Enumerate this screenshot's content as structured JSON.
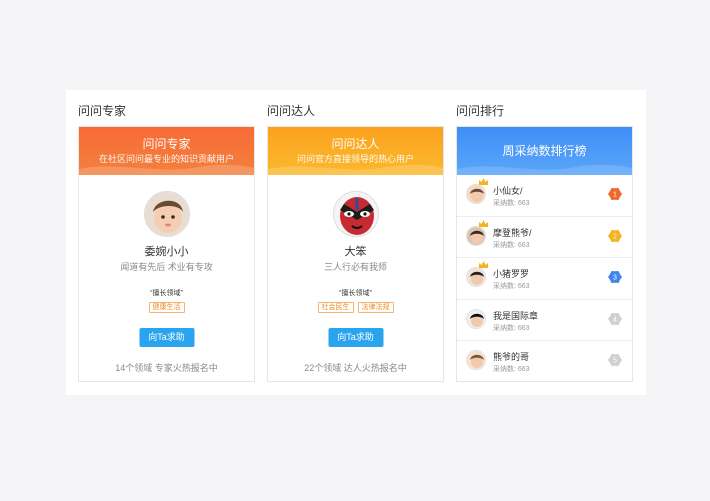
{
  "columns": [
    {
      "title": "问问专家",
      "card": {
        "head_title": "问问专家",
        "head_sub": "在社区问问最专业的知识贡献用户",
        "name": "委婉小小",
        "motto": "闻道有先后 术业有专攻",
        "good_label": "擅长领域",
        "tags": [
          "健康生活"
        ],
        "button": "向Ta求助",
        "footer": "14个领域 专家火热报名中"
      }
    },
    {
      "title": "问问达人",
      "card": {
        "head_title": "问问达人",
        "head_sub": "问问官方直接领导的热心用户",
        "name": "大笨",
        "motto": "三人行必有我师",
        "good_label": "擅长领域",
        "tags": [
          "社会民生",
          "法律法规"
        ],
        "button": "向Ta求助",
        "footer": "22个领域 达人火热报名中"
      }
    },
    {
      "title": "问问排行",
      "rank_title": "周采纳数排行榜",
      "rank_items": [
        {
          "name": "小仙女/",
          "count": "采纳数: 663",
          "rank": "1",
          "badge_color": "#f0682a"
        },
        {
          "name": "摩登熊爷/",
          "count": "采纳数: 663",
          "rank": "2",
          "badge_color": "#f6b320"
        },
        {
          "name": "小猪罗罗",
          "count": "采纳数: 663",
          "rank": "3",
          "badge_color": "#3f85ee"
        },
        {
          "name": "我是国际章",
          "count": "采纳数: 663",
          "rank": "4",
          "badge_color": "#d0d0d0"
        },
        {
          "name": "熊爷的哥",
          "count": "采纳数: 663",
          "rank": "5",
          "badge_color": "#d0d0d0"
        }
      ]
    }
  ]
}
